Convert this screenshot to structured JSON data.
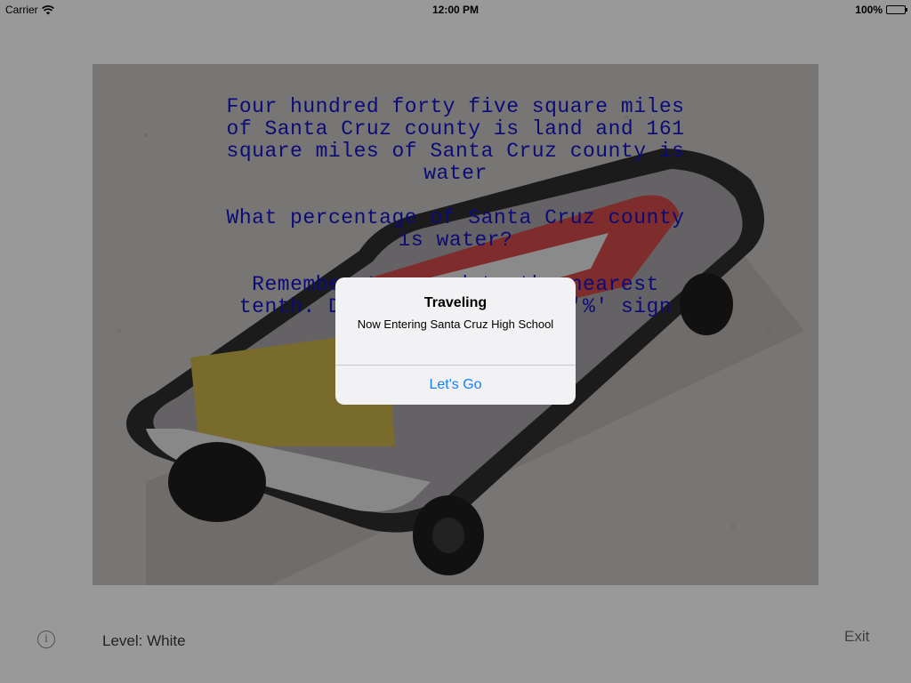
{
  "status_bar": {
    "carrier": "Carrier",
    "time": "12:00 PM",
    "battery": "100%",
    "icons": [
      "wifi-icon",
      "battery-icon"
    ]
  },
  "question": {
    "statement": "Four hundred forty five square miles of Santa Cruz county is land and 161 square miles of Santa Cruz county is water",
    "prompt": "What percentage of Santa Cruz county is water?",
    "instruction": "Remember to round to the nearest tenth. Do not include the '%' sign",
    "colors": {
      "text": "#1313c9"
    }
  },
  "bottom_bar": {
    "info_icon": "info-icon",
    "level": "Level: White",
    "exit": "Exit"
  },
  "alert": {
    "title": "Traveling",
    "message": "Now Entering Santa Cruz High School",
    "button": "Let's Go",
    "colors": {
      "button": "#157efb"
    }
  }
}
